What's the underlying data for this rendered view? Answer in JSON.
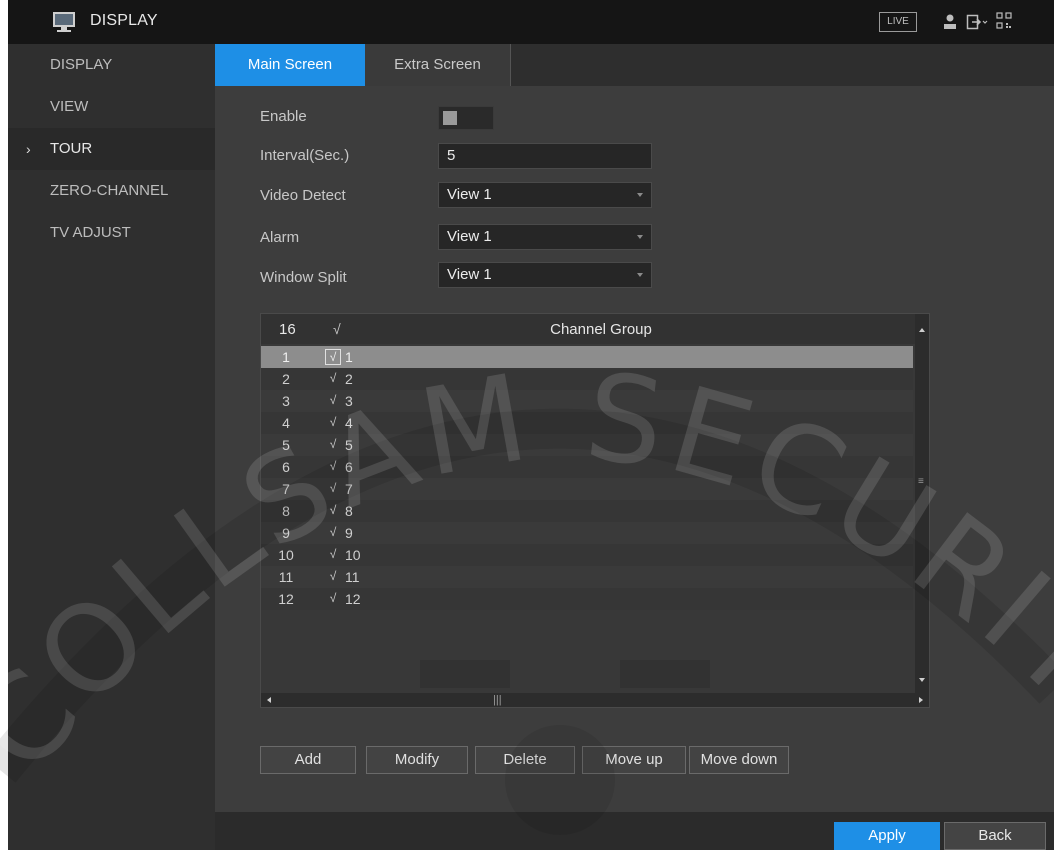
{
  "header": {
    "title": "DISPLAY",
    "live_label": "LIVE",
    "icons": [
      "monitor-icon",
      "user-icon",
      "logout-icon",
      "qr-code-icon"
    ]
  },
  "sidebar": {
    "items": [
      {
        "label": "DISPLAY",
        "active": false
      },
      {
        "label": "VIEW",
        "active": false
      },
      {
        "label": "TOUR",
        "active": true
      },
      {
        "label": "ZERO-CHANNEL",
        "active": false
      },
      {
        "label": "TV ADJUST",
        "active": false
      }
    ],
    "active_marker": "›"
  },
  "tabs": [
    {
      "label": "Main Screen",
      "active": true
    },
    {
      "label": "Extra Screen",
      "active": false
    }
  ],
  "form": {
    "enable_label": "Enable",
    "enable_on": false,
    "interval_label": "Interval(Sec.)",
    "interval_value": "5",
    "video_detect_label": "Video Detect",
    "video_detect_value": "View 1",
    "alarm_label": "Alarm",
    "alarm_value": "View 1",
    "window_split_label": "Window Split",
    "window_split_value": "View 1"
  },
  "table": {
    "count": "16",
    "check_header": "√",
    "group_header": "Channel Group",
    "rows": [
      {
        "num": "1",
        "check": "√",
        "value": "1",
        "selected": true
      },
      {
        "num": "2",
        "check": "√",
        "value": "2"
      },
      {
        "num": "3",
        "check": "√",
        "value": "3"
      },
      {
        "num": "4",
        "check": "√",
        "value": "4"
      },
      {
        "num": "5",
        "check": "√",
        "value": "5"
      },
      {
        "num": "6",
        "check": "√",
        "value": "6"
      },
      {
        "num": "7",
        "check": "√",
        "value": "7"
      },
      {
        "num": "8",
        "check": "√",
        "value": "8"
      },
      {
        "num": "9",
        "check": "√",
        "value": "9"
      },
      {
        "num": "10",
        "check": "√",
        "value": "10"
      },
      {
        "num": "11",
        "check": "√",
        "value": "11"
      },
      {
        "num": "12",
        "check": "√",
        "value": "12"
      }
    ]
  },
  "buttons": {
    "add": "Add",
    "modify": "Modify",
    "delete": "Delete",
    "move_up": "Move up",
    "move_down": "Move down",
    "apply": "Apply",
    "back": "Back"
  },
  "watermark": {
    "text": "COLLSAM SECURITY"
  },
  "colors": {
    "accent": "#1e8fe6",
    "background": "#3d3d3d",
    "sidebar": "#2f2f2f",
    "topbar": "#151515"
  }
}
